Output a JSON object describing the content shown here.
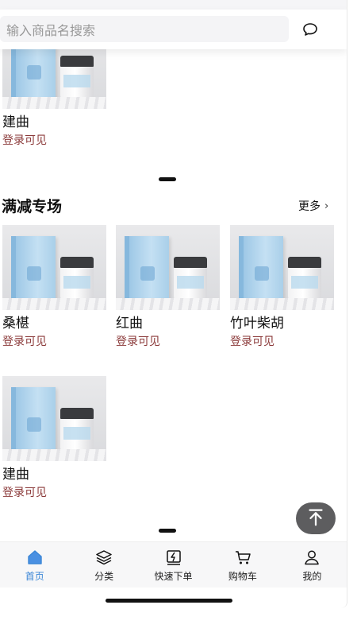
{
  "search": {
    "placeholder": "输入商品名搜索",
    "message_icon": "chat-bubble-icon"
  },
  "top_product": {
    "name": "建曲",
    "price_note": "登录可见"
  },
  "section": {
    "title": "满减专场",
    "more": "更多",
    "more_icon": "chevron-right-icon"
  },
  "products": [
    {
      "name": "桑椹",
      "price_note": "登录可见"
    },
    {
      "name": "红曲",
      "price_note": "登录可见"
    },
    {
      "name": "竹叶柴胡",
      "price_note": "登录可见"
    },
    {
      "name": "建曲",
      "price_note": "登录可见"
    }
  ],
  "back_to_top_icon": "arrow-up-icon",
  "tabbar": [
    {
      "label": "首页",
      "icon": "home-icon",
      "active": true
    },
    {
      "label": "分类",
      "icon": "layers-icon",
      "active": false
    },
    {
      "label": "快速下单",
      "icon": "lightning-icon",
      "active": false
    },
    {
      "label": "购物车",
      "icon": "cart-icon",
      "active": false
    },
    {
      "label": "我的",
      "icon": "user-icon",
      "active": false
    }
  ],
  "colors": {
    "accent": "#3b86d6",
    "price": "#8b3a3a",
    "fab": "#5d5d5f"
  }
}
